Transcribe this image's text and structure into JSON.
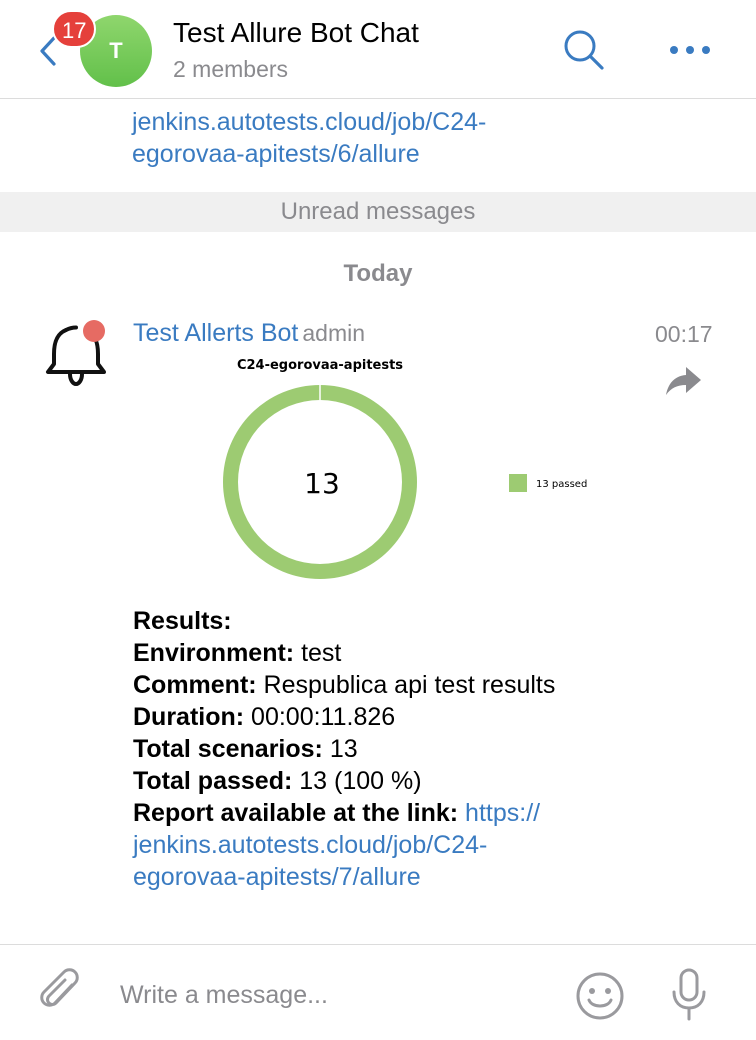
{
  "header": {
    "unread_count": "17",
    "avatar_letter": "T",
    "title": "Test Allure Bot Chat",
    "subtitle": "2 members",
    "avatar_color": "#6cc35a",
    "badge_color": "#e5403b"
  },
  "previous_message": {
    "link_line_1": "jenkins.autotests.cloud/job/C24-",
    "link_line_2": "egorovaa-apitests/6/allure"
  },
  "unread_label": "Unread messages",
  "date_label": "Today",
  "message": {
    "sender": "Test Allerts Bot",
    "role": "admin",
    "time": "00:17",
    "chart_data": {
      "type": "pie",
      "title": "C24-egorovaa-apitests",
      "center_label": "13",
      "slices": [
        {
          "name": "13 passed",
          "value": 13,
          "color": "#9dcb72"
        }
      ],
      "legend_position": "right"
    },
    "results_label": "Results:",
    "environment_label": "Environment:",
    "environment_value": " test",
    "comment_label": "Comment:",
    "comment_value": " Respublica api test results",
    "duration_label": "Duration:",
    "duration_value": " 00:00:11.826",
    "total_scenarios_label": "Total scenarios:",
    "total_scenarios_value": " 13",
    "total_passed_label": "Total passed:",
    "total_passed_value": " 13 (100 %)",
    "report_label": "Report available at the link:",
    "report_link_1": "https://",
    "report_link_2": "jenkins.autotests.cloud/job/C24-",
    "report_link_3": "egorovaa-apitests/7/allure"
  },
  "composer": {
    "placeholder": "Write a message..."
  },
  "colors": {
    "link": "#3a7bc1",
    "accent": "#3a7bc1",
    "muted": "#8a8a8e"
  }
}
